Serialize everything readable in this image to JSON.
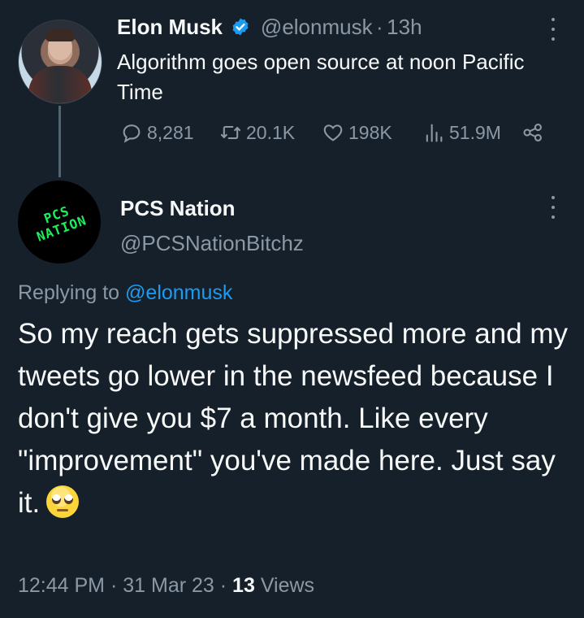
{
  "parent_tweet": {
    "author_name": "Elon Musk",
    "handle": "@elonmusk",
    "time_sep": "·",
    "time": "13h",
    "text": "Algorithm goes open source at noon Pacific Time",
    "stats": {
      "replies": "8,281",
      "retweets": "20.1K",
      "likes": "198K",
      "views": "51.9M"
    }
  },
  "reply_tweet": {
    "author_name": "PCS Nation",
    "handle": "@PCSNationBitchz",
    "avatar_logo_text": "PCS NATION",
    "replying_to_prefix": "Replying to ",
    "replying_to_handle": "@elonmusk",
    "text": "So my reach gets suppressed more and my tweets go lower in the newsfeed because I don't give you $7 a month. Like every \"improvement\" you've made here. Just say it.",
    "time": "12:44 PM",
    "date": "31 Mar 23",
    "sep": "·",
    "views_count": "13",
    "views_label": "Views"
  },
  "colors": {
    "background": "#15202b",
    "text_primary": "#f7f9f9",
    "text_secondary": "#8b98a5",
    "accent_blue": "#1d9bf0",
    "logo_green": "#19f15c"
  }
}
